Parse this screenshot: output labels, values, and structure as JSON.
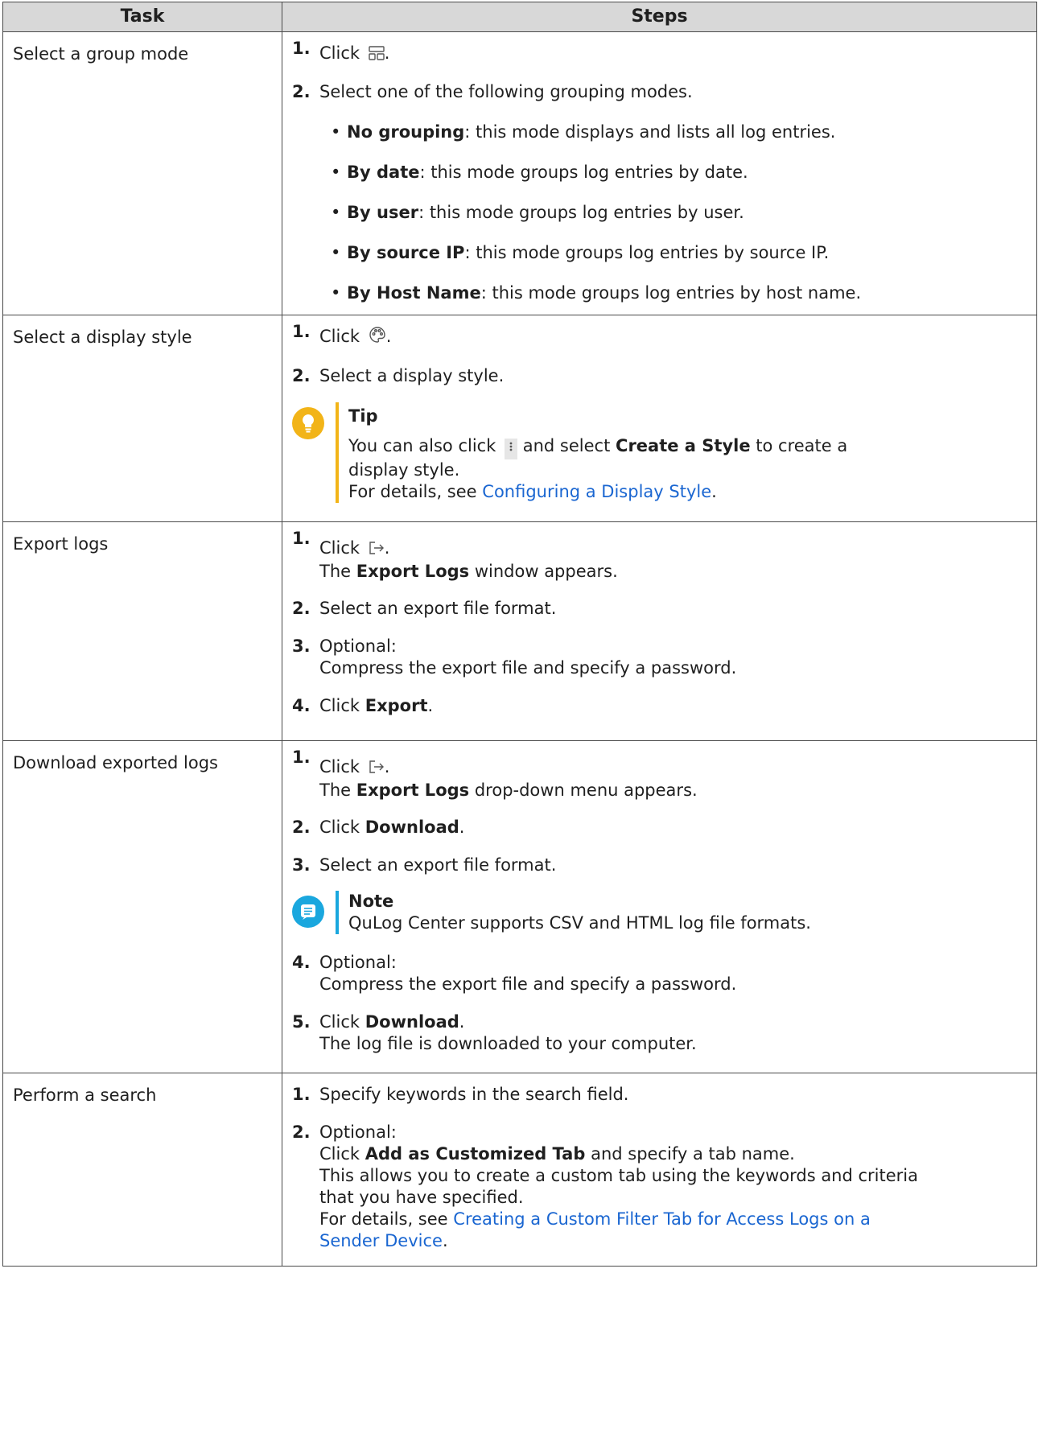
{
  "header": {
    "task": "Task",
    "steps": "Steps"
  },
  "rows": {
    "group": {
      "task": "Select a group mode",
      "s1_num": "1.",
      "s1_text": "Click",
      "s1_after": ".",
      "s2_num": "2.",
      "s2_text": "Select one of the following grouping modes.",
      "modes": [
        {
          "name": "No grouping",
          "desc": ": this mode displays and lists all log entries."
        },
        {
          "name": "By date",
          "desc": ": this mode groups log entries by date."
        },
        {
          "name": "By user",
          "desc": ": this mode groups log entries by user."
        },
        {
          "name": "By source IP",
          "desc": ": this mode groups log entries by source IP."
        },
        {
          "name": "By Host Name",
          "desc": ": this mode groups log entries by host name."
        }
      ]
    },
    "display": {
      "task": "Select a display style",
      "s1_num": "1.",
      "s1_text": "Click",
      "s1_after": ".",
      "s2_num": "2.",
      "s2_text": "Select a display style.",
      "tip_title": "Tip",
      "tip_a": "You can also click",
      "tip_b": "and select",
      "tip_bold": "Create a Style",
      "tip_c": "to create a",
      "tip_d": "display style.",
      "tip_e": "For details, see",
      "tip_link": "Configuring a Display Style",
      "tip_end": "."
    },
    "export": {
      "task": "Export logs",
      "s1_num": "1.",
      "s1_text": "Click",
      "s1_after": ".",
      "s1_l2a": "The",
      "s1_l2b": "Export Logs",
      "s1_l2c": "window appears.",
      "s2_num": "2.",
      "s2_text": "Select an export file format.",
      "s3_num": "3.",
      "s3_text": "Optional:",
      "s3_l2": "Compress the export file and specify a password.",
      "s4_num": "4.",
      "s4_text": "Click",
      "s4_bold": "Export",
      "s4_end": "."
    },
    "download": {
      "task": "Download exported logs",
      "s1_num": "1.",
      "s1_text": "Click",
      "s1_after": ".",
      "s1_l2a": "The",
      "s1_l2b": "Export Logs",
      "s1_l2c": "drop-down menu appears.",
      "s2_num": "2.",
      "s2_text": "Click",
      "s2_bold": "Download",
      "s2_end": ".",
      "s3_num": "3.",
      "s3_text": "Select an export file format.",
      "note_title": "Note",
      "note_text": "QuLog Center supports CSV and HTML log file formats.",
      "s4_num": "4.",
      "s4_text": "Optional:",
      "s4_l2": "Compress the export file and specify a password.",
      "s5_num": "5.",
      "s5_text": "Click",
      "s5_bold": "Download",
      "s5_end": ".",
      "s5_l2": "The log file is downloaded to your computer."
    },
    "search": {
      "task": "Perform a search",
      "s1_num": "1.",
      "s1_text": "Specify keywords in the search field.",
      "s2_num": "2.",
      "s2_text": "Optional:",
      "s2_l2a": "Click",
      "s2_l2b": "Add as Customized Tab",
      "s2_l2c": "and specify a tab name.",
      "s2_l3": "This allows you to create a custom tab using the keywords and criteria",
      "s2_l4": "that you have specified.",
      "s2_l5": "For details, see",
      "s2_link1": "Creating a Custom Filter Tab for Access Logs on a",
      "s2_link2": "Sender Device",
      "s2_end": "."
    }
  },
  "icons": {
    "group": "group-mode-icon",
    "palette": "palette-icon",
    "more": "more-vertical-icon",
    "export": "export-icon",
    "tip": "lightbulb-icon",
    "note": "note-icon"
  },
  "colors": {
    "header_bg": "#d8d8d8",
    "link": "#1a66d1",
    "tip_accent": "#f2b418",
    "note_accent": "#1aa7de"
  }
}
